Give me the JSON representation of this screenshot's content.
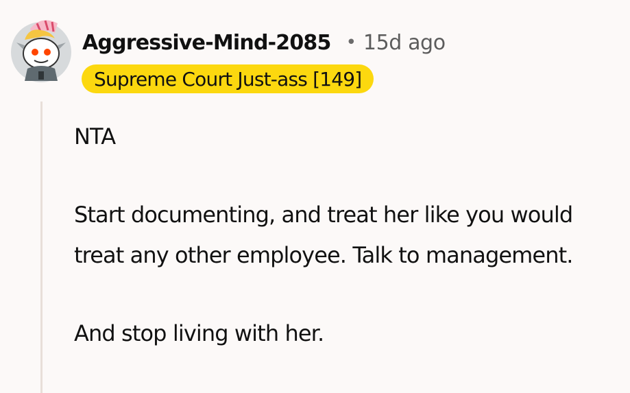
{
  "comment": {
    "author": "Aggressive-Mind-2085",
    "separator": "•",
    "timestamp": "15d ago",
    "flair": "Supreme Court Just-ass [149]",
    "paragraphs": [
      "NTA",
      "Start documenting, and treat her like you would treat any other employee. Talk to management.",
      "And stop living with her."
    ]
  },
  "colors": {
    "background": "#fcf9f8",
    "flair_background": "#fcd80f",
    "thread_line": "#e8dfd9",
    "muted_text": "#5c5c5c"
  }
}
